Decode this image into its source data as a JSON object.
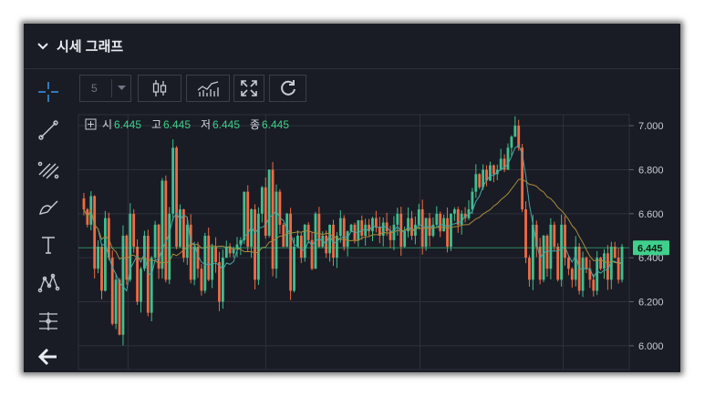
{
  "header": {
    "title": "시세 그래프"
  },
  "toolbar": {
    "period_value": "5"
  },
  "icons": {
    "collapse": "chevron-down-icon",
    "crosshair": "crosshair-icon",
    "trendline": "trend-line-icon",
    "fib": "fibonacci-icon",
    "brush": "brush-icon",
    "text": "text-icon",
    "pattern": "pattern-icon",
    "measure": "measure-icon",
    "back": "arrow-left-icon",
    "candle": "candlestick-icon",
    "indicator": "indicator-icon",
    "fullscreen": "fullscreen-icon",
    "refresh": "refresh-icon"
  },
  "colors": {
    "background": "#191c24",
    "up": "#3fbf8f",
    "down": "#f06a45",
    "ma_short": "#4aa6a6",
    "ma_long": "#a88a3c",
    "price_tag": "#3fd08c",
    "toolbar_accent": "#3b8fe0"
  },
  "legend": {
    "open_label": "시",
    "open_value": "6.445",
    "high_label": "고",
    "high_value": "6.445",
    "low_label": "저",
    "low_value": "6.445",
    "close_label": "종",
    "close_value": "6.445"
  },
  "chart_data": {
    "type": "candlestick",
    "ylim": [
      5.95,
      7.05
    ],
    "yticks": [
      "7.000",
      "6.800",
      "6.600",
      "6.400",
      "6.200",
      "6.000"
    ],
    "current_price": "6.445",
    "grid": true,
    "close": [
      6.62,
      6.55,
      6.68,
      6.35,
      6.45,
      6.25,
      6.58,
      6.4,
      6.1,
      6.3,
      6.05,
      6.5,
      6.3,
      6.6,
      6.45,
      6.2,
      6.35,
      6.5,
      6.15,
      6.4,
      6.55,
      6.35,
      6.75,
      6.3,
      6.6,
      6.9,
      6.45,
      6.62,
      6.4,
      6.55,
      6.3,
      6.45,
      6.35,
      6.25,
      6.5,
      6.3,
      6.45,
      6.38,
      6.2,
      6.4,
      6.45,
      6.42,
      6.44,
      6.46,
      6.48,
      6.7,
      6.45,
      6.62,
      6.3,
      6.6,
      6.72,
      6.5,
      6.8,
      6.35,
      6.7,
      6.55,
      6.45,
      6.6,
      6.25,
      6.45,
      6.5,
      6.4,
      6.55,
      6.48,
      6.35,
      6.6,
      6.45,
      6.5,
      6.42,
      6.55,
      6.4,
      6.5,
      6.58,
      6.45,
      6.52,
      6.55,
      6.48,
      6.57,
      6.5,
      6.55,
      6.52,
      6.58,
      6.54,
      6.5,
      6.56,
      6.52,
      6.48,
      6.55,
      6.6,
      6.45,
      6.52,
      6.58,
      6.5,
      6.55,
      6.62,
      6.45,
      6.58,
      6.5,
      6.55,
      6.6,
      6.52,
      6.58,
      6.45,
      6.6,
      6.62,
      6.55,
      6.6,
      6.58,
      6.62,
      6.7,
      6.78,
      6.72,
      6.8,
      6.75,
      6.82,
      6.78,
      6.8,
      6.85,
      6.8,
      6.9,
      6.95,
      7.0,
      6.9,
      6.62,
      6.4,
      6.3,
      6.55,
      6.45,
      6.3,
      6.5,
      6.35,
      6.55,
      6.45,
      6.3,
      6.55,
      6.4,
      6.35,
      6.3,
      6.45,
      6.25,
      6.4,
      6.35,
      6.3,
      6.25,
      6.4,
      6.35,
      6.42,
      6.3,
      6.45,
      6.4,
      6.3,
      6.45
    ]
  }
}
